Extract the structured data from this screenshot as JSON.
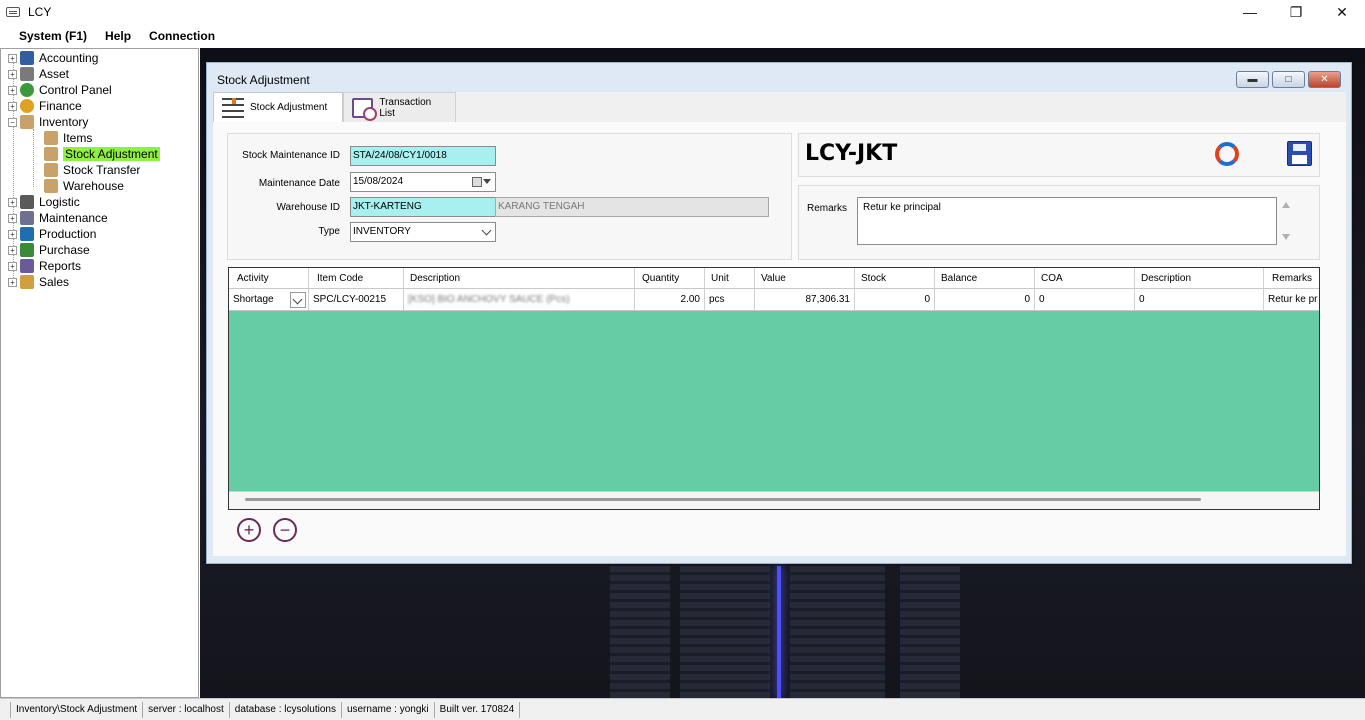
{
  "app": {
    "title": "LCY"
  },
  "menu": [
    "System (F1)",
    "Help",
    "Connection"
  ],
  "tree": {
    "items": [
      {
        "label": "Accounting",
        "icon": "accounting-icon"
      },
      {
        "label": "Asset",
        "icon": "asset-icon"
      },
      {
        "label": "Control Panel",
        "icon": "control-panel-icon"
      },
      {
        "label": "Finance",
        "icon": "finance-icon"
      },
      {
        "label": "Inventory",
        "icon": "inventory-icon"
      },
      {
        "label": "Items",
        "icon": "box-icon"
      },
      {
        "label": "Stock Adjustment",
        "icon": "box-icon"
      },
      {
        "label": "Stock Transfer",
        "icon": "box-icon"
      },
      {
        "label": "Warehouse",
        "icon": "box-icon"
      },
      {
        "label": "Logistic",
        "icon": "logistic-icon"
      },
      {
        "label": "Maintenance",
        "icon": "maintenance-icon"
      },
      {
        "label": "Production",
        "icon": "production-icon"
      },
      {
        "label": "Purchase",
        "icon": "purchase-icon"
      },
      {
        "label": "Reports",
        "icon": "reports-icon"
      },
      {
        "label": "Sales",
        "icon": "sales-icon"
      }
    ],
    "selected": "Stock Adjustment"
  },
  "dialog": {
    "title": "Stock Adjustment",
    "tabs": [
      "Stock Adjustment",
      "Transaction List"
    ],
    "form": {
      "id_label": "Stock Maintenance ID",
      "id_value": "STA/24/08/CY1/0018",
      "date_label": "Maintenance Date",
      "date_value": "15/08/2024",
      "warehouse_label": "Warehouse ID",
      "warehouse_value": "JKT-KARTENG",
      "warehouse_name": "KARANG TENGAH",
      "type_label": "Type",
      "type_value": "INVENTORY"
    },
    "company_code": "LCY-JKT",
    "remarks_label": "Remarks",
    "remarks_value": "Retur ke principal",
    "grid": {
      "columns": [
        "Activity",
        "Item Code",
        "Description",
        "Quantity",
        "Unit",
        "Value",
        "Stock",
        "Balance",
        "COA",
        "Description",
        "Remarks"
      ],
      "rows": [
        [
          "Shortage",
          "SPC/LCY-00215",
          "[KSO] BIO ANCHOVY SAUCE (Pcs)",
          "2.00",
          "pcs",
          "87,306.31",
          "0",
          "0",
          "0",
          "0",
          "Retur ke pr"
        ]
      ]
    }
  },
  "status": {
    "path": "Inventory\\Stock Adjustment",
    "server": "server : localhost",
    "database": "database : lcysolutions",
    "username": "username : yongki",
    "build": "Built ver. 170824"
  },
  "colors": {
    "grid_bg": "#66cca6",
    "input_highlight": "#a8f0f0",
    "selected_tree": "#8ef040"
  }
}
